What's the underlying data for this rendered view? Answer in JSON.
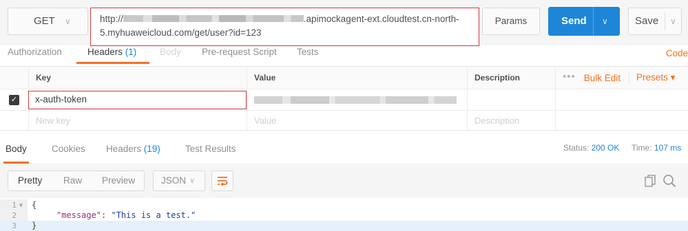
{
  "request": {
    "method": "GET",
    "url_line1_prefix": "http://",
    "url_line1_suffix": ".apimockagent-ext.cloudtest.cn-north-",
    "url_line2": "5.myhuaweicloud.com/get/user?id=123",
    "params_label": "Params",
    "send_label": "Send",
    "save_label": "Save"
  },
  "request_tabs": {
    "authorization": "Authorization",
    "headers": "Headers",
    "headers_count": "(1)",
    "body": "Body",
    "prerequest": "Pre-request Script",
    "tests": "Tests",
    "code": "Code"
  },
  "headers_table": {
    "columns": {
      "key": "Key",
      "value": "Value",
      "description": "Description",
      "bulk_edit": "Bulk Edit",
      "presets": "Presets ▾"
    },
    "rows": [
      {
        "checked": true,
        "key": "x-auth-token",
        "value": "",
        "description": ""
      }
    ],
    "new_row": {
      "key_placeholder": "New key",
      "value_placeholder": "Value",
      "description_placeholder": "Description"
    }
  },
  "response_tabs": {
    "body": "Body",
    "cookies": "Cookies",
    "headers": "Headers",
    "headers_count": "(19)",
    "test_results": "Test Results",
    "status_label": "Status:",
    "status_value": "200 OK",
    "time_label": "Time:",
    "time_value": "107 ms"
  },
  "response_toolbar": {
    "pretty": "Pretty",
    "raw": "Raw",
    "preview": "Preview",
    "format": "JSON"
  },
  "response_body": {
    "lines": [
      {
        "num": "1",
        "open": "{"
      },
      {
        "num": "2",
        "key": "\"message\"",
        "colon": ": ",
        "value": "\"This is a test.\""
      },
      {
        "num": "3",
        "close": "}"
      }
    ]
  },
  "colors": {
    "accent_orange": "#f47023",
    "send_blue": "#1e86d8",
    "highlight_red": "#d7353d"
  },
  "icons": [
    "chevron-down-icon",
    "checkbox-icon",
    "wrap-lines-icon",
    "copy-icon",
    "search-icon",
    "more-dots-icon"
  ]
}
